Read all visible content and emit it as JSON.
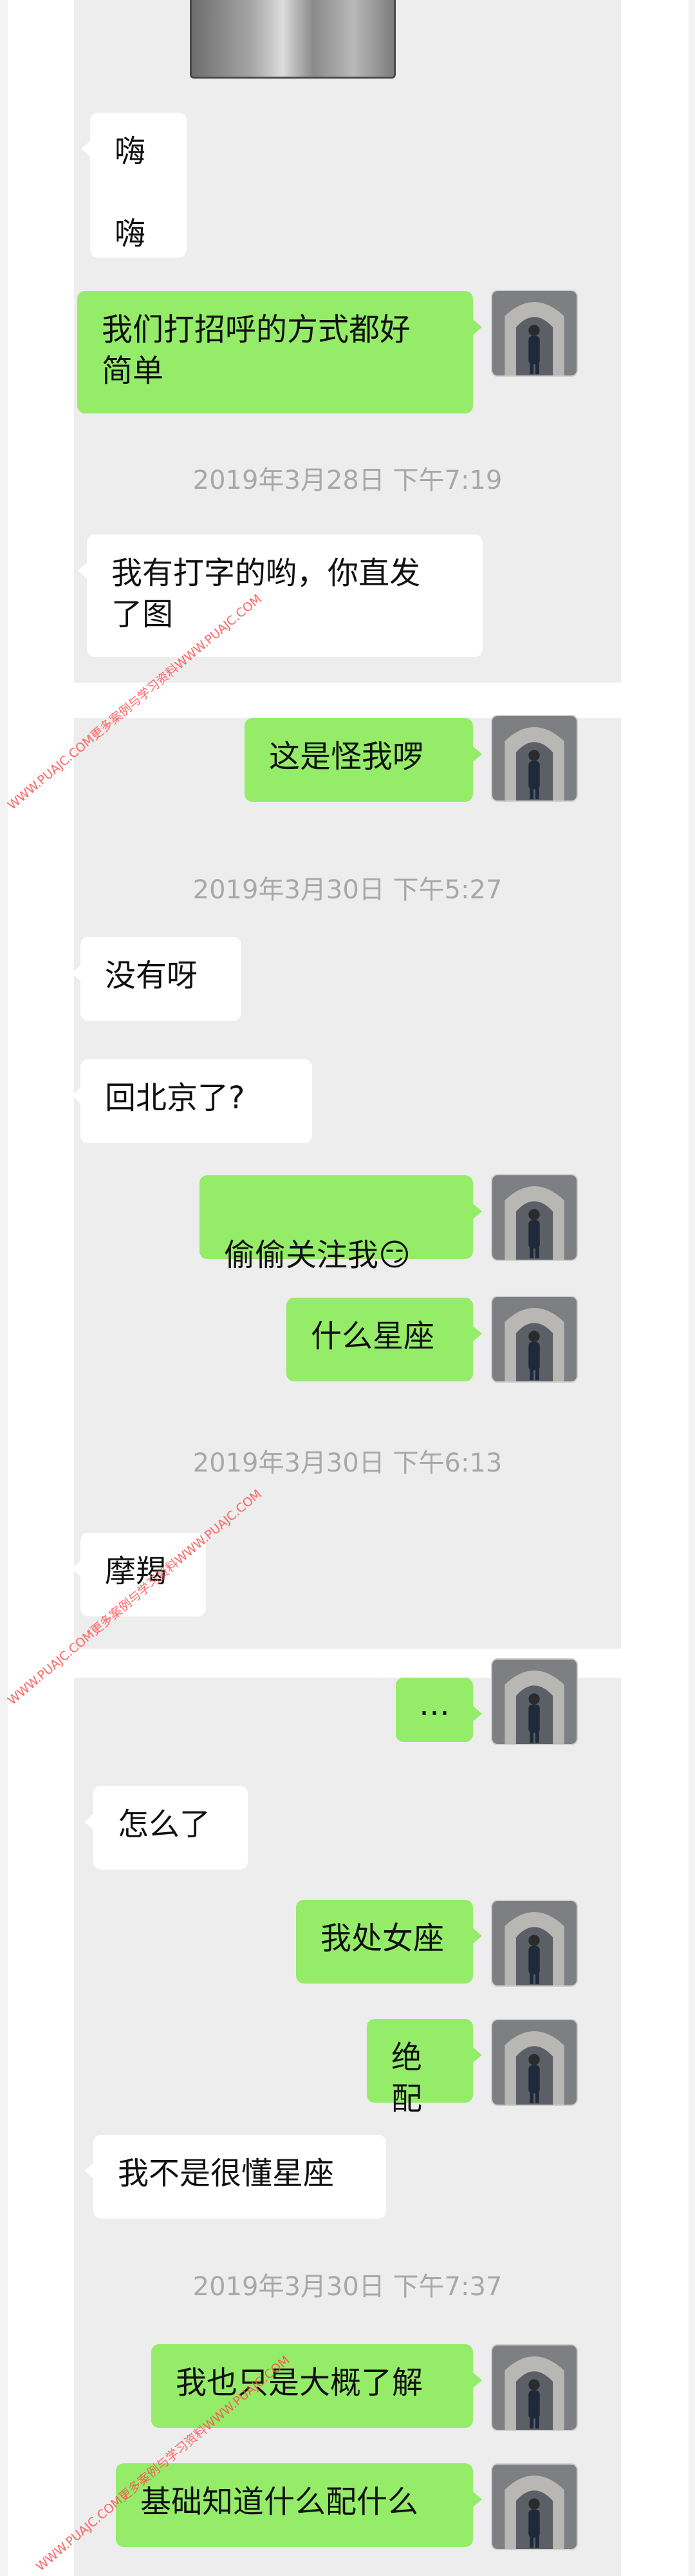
{
  "colors": {
    "chat_background": "#ededed",
    "incoming_bubble": "#ffffff",
    "outgoing_bubble": "#95ec69",
    "timestamp_text": "#a8a8a8",
    "watermark_text": "#ff4c4c"
  },
  "panels": [
    {
      "messages": [
        {
          "side": "in",
          "text": "嗨\n\n嗨"
        },
        {
          "side": "out",
          "text": "我们打招呼的方式都好\n简单"
        }
      ],
      "timestamp": "2019年3月28日 下午7:19",
      "after": [
        {
          "side": "in",
          "text": "我有打字的哟，你直发\n了图"
        }
      ]
    },
    {
      "messages": [
        {
          "side": "out",
          "text": "这是怪我啰"
        }
      ],
      "timestamp_1": "2019年3月30日 下午5:27",
      "after_1": [
        {
          "side": "in",
          "text": "没有呀"
        },
        {
          "side": "in",
          "text": "回北京了?"
        },
        {
          "side": "out",
          "text": "偷偷关注我"
        },
        {
          "side": "out",
          "text": "什么星座"
        }
      ],
      "emoji": "😏",
      "timestamp_2": "2019年3月30日 下午6:13",
      "after_2": [
        {
          "side": "in",
          "text": "摩羯"
        }
      ]
    },
    {
      "messages": [
        {
          "side": "out",
          "text": "…"
        },
        {
          "side": "in",
          "text": "怎么了"
        },
        {
          "side": "out",
          "text": "我处女座"
        },
        {
          "side": "out",
          "text": "绝配"
        },
        {
          "side": "in",
          "text": "我不是很懂星座"
        }
      ],
      "timestamp": "2019年3月30日 下午7:37",
      "after": [
        {
          "side": "out",
          "text": "我也只是大概了解"
        },
        {
          "side": "out",
          "text": "基础知道什么配什么"
        }
      ]
    }
  ],
  "watermark": "WWW.PUAJC.COM更多案例与学习资料WWW.PUAJC.COM",
  "avatar_icon": "person-photo-icon"
}
